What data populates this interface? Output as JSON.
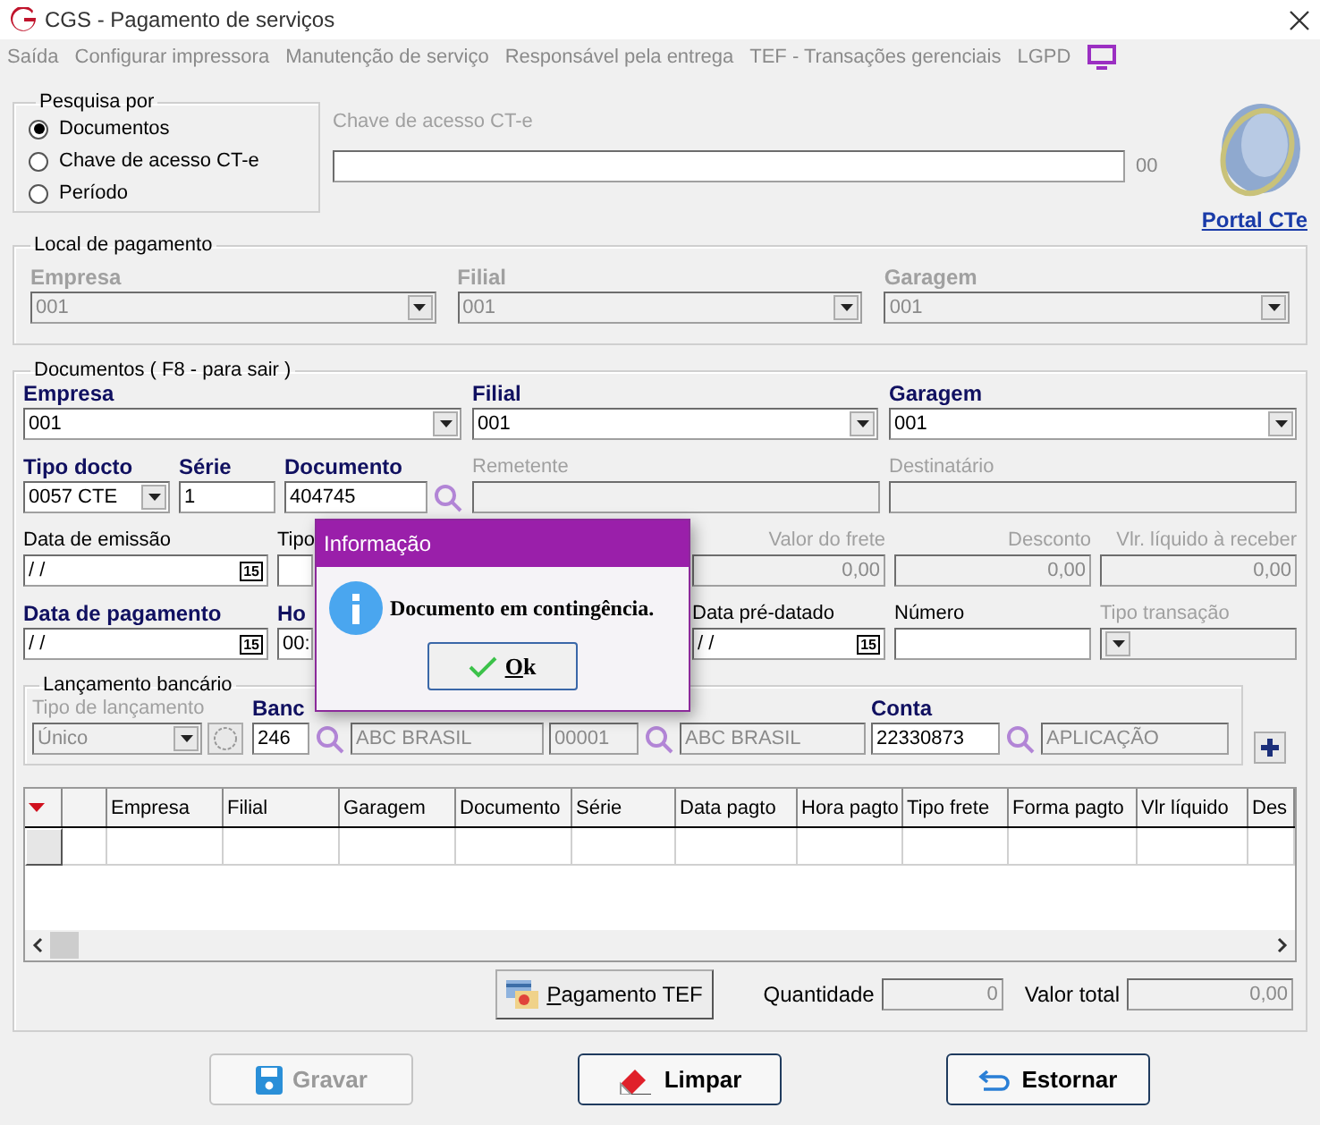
{
  "window": {
    "title": "CGS - Pagamento de serviços"
  },
  "menu": [
    "Saída",
    "Configurar impressora",
    "Manutenção de serviço",
    "Responsável pela entrega",
    "TEF - Transações gerenciais",
    "LGPD"
  ],
  "search_by": {
    "legend": "Pesquisa por",
    "options": [
      {
        "label": "Documentos",
        "selected": true
      },
      {
        "label": "Chave de acesso CT-e",
        "selected": false
      },
      {
        "label": "Período",
        "selected": false
      }
    ]
  },
  "access_key": {
    "label": "Chave de acesso CT-e",
    "disabled": true,
    "suffix": "00"
  },
  "portal_link": "Portal CTe",
  "payment_location": {
    "legend": "Local de pagamento",
    "fields": [
      {
        "kind": "combo",
        "label": "Empresa",
        "required": true,
        "value": "001",
        "disabled": true
      },
      {
        "kind": "combo",
        "label": "Filial",
        "required": true,
        "value": "001",
        "disabled": true
      },
      {
        "kind": "combo",
        "label": "Garagem",
        "required": true,
        "value": "001",
        "disabled": true
      }
    ]
  },
  "documents": {
    "legend": "Documentos ( F8 - para sair )",
    "sections": [
      {
        "fields": [
          {
            "kind": "combo",
            "label": "Empresa",
            "required": true,
            "value": "001",
            "disabled": false
          },
          {
            "kind": "combo",
            "label": "Filial",
            "required": true,
            "value": "001",
            "disabled": false
          },
          {
            "kind": "combo",
            "label": "Garagem",
            "required": true,
            "value": "001",
            "disabled": false
          }
        ]
      },
      {
        "fields": [
          {
            "kind": "combo",
            "label": "Tipo docto",
            "required": true,
            "value": "0057 CTE",
            "disabled": false
          },
          {
            "kind": "text",
            "label": "Série",
            "required": true,
            "value": "1",
            "disabled": false
          },
          {
            "kind": "lookup",
            "label": "Documento",
            "required": true,
            "value": "404745",
            "disabled": false
          },
          {
            "kind": "text",
            "label": "Remetente",
            "required": false,
            "disabled": true
          },
          {
            "kind": "text",
            "label": "Destinatário",
            "required": false,
            "disabled": true
          }
        ]
      },
      {
        "fields": [
          {
            "kind": "date",
            "label": "Data de emissão",
            "required": false,
            "value": " / /",
            "calendar": "15",
            "disabled": false
          },
          {
            "kind": "text",
            "label": "Tipo",
            "required": false,
            "disabled": false
          },
          {
            "kind": "number",
            "label": "Valor do frete",
            "required": false,
            "value": "0,00",
            "disabled": true
          },
          {
            "kind": "number",
            "label": "Desconto",
            "required": false,
            "value": "0,00",
            "disabled": true
          },
          {
            "kind": "number",
            "label": "Vlr. líquido à receber",
            "required": false,
            "value": "0,00",
            "disabled": true
          }
        ]
      },
      {
        "fields": [
          {
            "kind": "date",
            "label": "Data de pagamento",
            "required": true,
            "value": " / /",
            "calendar": "15",
            "disabled": false
          },
          {
            "kind": "text",
            "label": "Ho",
            "required": true,
            "value": "00:",
            "disabled": false
          },
          {
            "kind": "date",
            "label": "Data pré-datado",
            "required": false,
            "value": " / /",
            "calendar": "15",
            "disabled": false
          },
          {
            "kind": "text",
            "label": "Número",
            "required": false,
            "disabled": false
          },
          {
            "kind": "combo",
            "label": "Tipo transação",
            "required": false,
            "disabled": true
          }
        ]
      }
    ],
    "bank": {
      "legend": "Lançamento bancário",
      "fields": [
        {
          "kind": "combo",
          "label": "Tipo de lançamento",
          "required": false,
          "value": "Único",
          "disabled": true
        },
        {
          "kind": "circle"
        },
        {
          "kind": "lookup",
          "label": "Banc",
          "required": true,
          "value": "246",
          "disabled": false
        },
        {
          "kind": "text",
          "value": "ABC BRASIL",
          "disabled": true
        },
        {
          "kind": "lookup",
          "value": "00001",
          "disabled": true
        },
        {
          "kind": "text",
          "value": "ABC BRASIL",
          "disabled": true
        },
        {
          "kind": "lookup",
          "label": "Conta",
          "required": true,
          "value": "22330873",
          "disabled": false
        },
        {
          "kind": "text",
          "value": "APLICAÇÃO",
          "disabled": true
        }
      ]
    },
    "table": {
      "columns": [
        "Empresa",
        "Filial",
        "Garagem",
        "Documento",
        "Série",
        "Data pagto",
        "Hora pagto",
        "Tipo frete",
        "Forma pagto",
        "Vlr líquido",
        "Des"
      ]
    },
    "tef_button": "Pagamento TEF",
    "totals": [
      {
        "label": "Quantidade",
        "value": "0"
      },
      {
        "label": "Valor total",
        "value": "0,00"
      }
    ]
  },
  "buttons": [
    {
      "kind": "save",
      "label": "Gravar",
      "disabled": true
    },
    {
      "kind": "clear",
      "label": "Limpar",
      "disabled": false
    },
    {
      "kind": "undo",
      "label": "Estornar",
      "disabled": false
    }
  ],
  "dialog": {
    "title": "Informação",
    "message": "Documento em contingência.",
    "button": "Ok"
  }
}
